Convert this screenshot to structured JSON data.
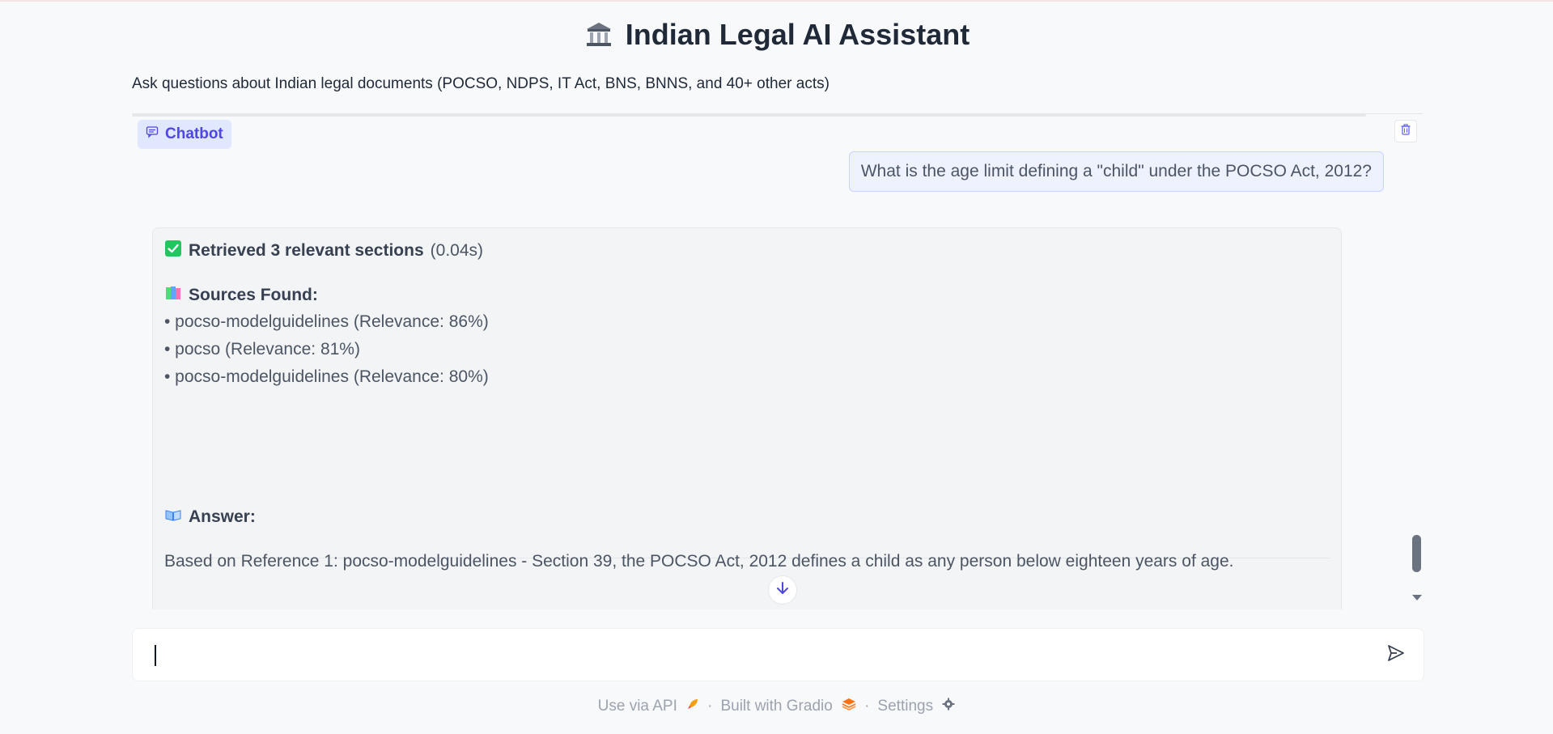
{
  "header": {
    "title": "Indian Legal AI Assistant",
    "subtitle": "Ask questions about Indian legal documents (POCSO, NDPS, IT Act, BNS, BNNS, and 40+ other acts)"
  },
  "chatbot": {
    "label": "Chatbot",
    "messages": {
      "user": "What is the age limit defining a \"child\" under the POCSO Act, 2012?",
      "bot": {
        "retrieved_bold": "Retrieved 3 relevant sections",
        "retrieved_time": "(0.04s)",
        "sources_heading": "Sources Found:",
        "sources": [
          "• pocso-modelguidelines (Relevance: 86%)",
          "• pocso (Relevance: 81%)",
          "• pocso-modelguidelines (Relevance: 80%)"
        ],
        "answer_heading": "Answer:",
        "answer_text": "Based on Reference 1: pocso-modelguidelines - Section 39, the POCSO Act, 2012 defines a child as any person below eighteen years of age."
      }
    }
  },
  "input": {
    "value": "",
    "placeholder": ""
  },
  "footer": {
    "api": "Use via API",
    "gradio": "Built with Gradio",
    "settings": "Settings",
    "separator": "·"
  },
  "colors": {
    "accent": "#4f46e5",
    "label_bg": "#e0e7ff",
    "user_bubble_bg": "#eef2ff",
    "bot_bubble_bg": "#f3f4f6",
    "check_green": "#22c55e"
  },
  "icons": [
    "building-icon",
    "chat-icon",
    "trash-icon",
    "check-icon",
    "books-icon",
    "open-book-icon",
    "arrow-down-icon",
    "send-icon",
    "rocket-icon",
    "gradio-logo-icon",
    "gear-icon"
  ]
}
